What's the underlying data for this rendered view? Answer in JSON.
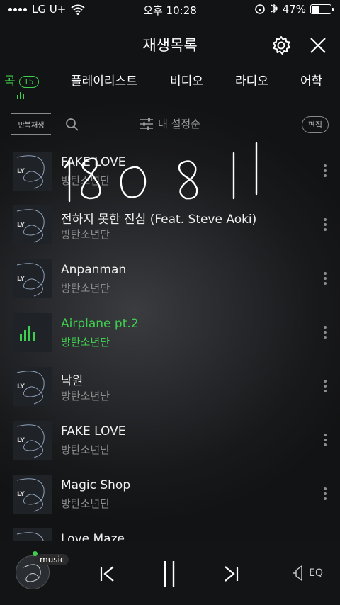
{
  "status_bar": {
    "carrier": "LG U+",
    "time": "오후 10:28",
    "battery_percent": "47%",
    "battery_level": 0.47
  },
  "header": {
    "title": "재생목록",
    "icons": [
      "settings-gear-icon",
      "close-x-icon"
    ]
  },
  "tabs": [
    {
      "label": "곡",
      "badge": "15",
      "active": true
    },
    {
      "label": "플레이리스트"
    },
    {
      "label": "비디오"
    },
    {
      "label": "라디오"
    },
    {
      "label": "어학"
    }
  ],
  "toolbar": {
    "repeat_label": "반복재생",
    "sort_label": "내 설정순",
    "edit_label": "편집"
  },
  "songs": [
    {
      "title": "FAKE LOVE",
      "artist": "방탄소년단"
    },
    {
      "title": "전하지 못한 진심 (Feat. Steve Aoki)",
      "artist": "방탄소년단"
    },
    {
      "title": "Anpanman",
      "artist": "방탄소년단"
    },
    {
      "title": "Airplane pt.2",
      "artist": "방탄소년단",
      "playing": true
    },
    {
      "title": "낙원",
      "artist": "방탄소년단"
    },
    {
      "title": "FAKE LOVE",
      "artist": "방탄소년단"
    },
    {
      "title": "Magic Shop",
      "artist": "방탄소년단"
    },
    {
      "title": "Love Maze",
      "artist": ""
    }
  ],
  "album_art_text": "LY",
  "handwriting": "180811",
  "player": {
    "badge": "music",
    "eq_label": "EQ",
    "accent_color": "#3fcf4e"
  }
}
